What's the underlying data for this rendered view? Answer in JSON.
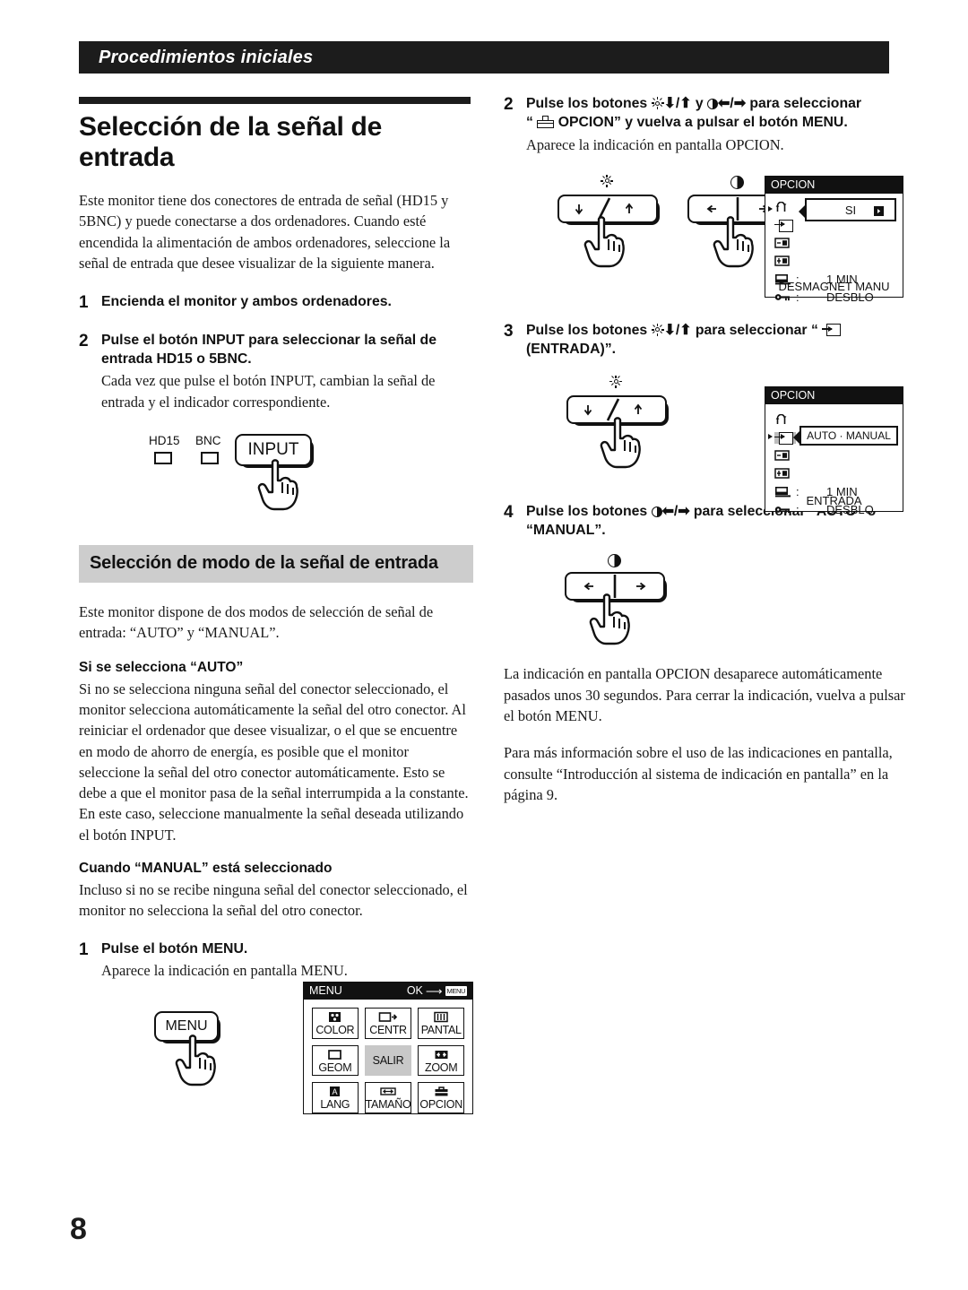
{
  "running_head": "Procedimientos iniciales",
  "page_number": "8",
  "left": {
    "title": "Selección de la señal de entrada",
    "intro": "Este monitor tiene dos conectores de entrada de señal (HD15 y 5BNC) y puede conectarse a dos ordenadores. Cuando esté encendida la alimentación de ambos ordenadores, seleccione la señal de entrada que desee visualizar de la siguiente manera.",
    "steps": [
      {
        "num": "1",
        "title": "Encienda el monitor y ambos ordenadores.",
        "sub": ""
      },
      {
        "num": "2",
        "title": "Pulse el botón INPUT para seleccionar la señal de entrada HD15 o 5BNC.",
        "sub": "Cada vez que pulse el botón INPUT, cambian la señal de entrada y el indicador correspondiente."
      }
    ],
    "input_illus": {
      "label_hd15": "HD15",
      "label_bnc": "BNC",
      "button_label": "INPUT"
    },
    "subhead": "Selección de modo de la señal de entrada",
    "mode_intro": "Este monitor dispone de dos modos de selección de señal de entrada: “AUTO” y “MANUAL”.",
    "auto_head": "Si se selecciona “AUTO”",
    "auto_body": "Si no se selecciona ninguna señal del conector seleccionado, el monitor selecciona automáticamente la señal del otro conector. Al reiniciar el ordenador que desee visualizar, o el que se encuentre en modo de ahorro de energía, es posible que el monitor seleccione la señal del otro conector automáticamente. Esto se debe a que el monitor pasa de la señal interrumpida a la constante. En este caso, seleccione manualmente la señal deseada utilizando el botón INPUT.",
    "manual_head": "Cuando “MANUAL” está seleccionado",
    "manual_body": "Incluso si no se recibe ninguna señal del conector seleccionado, el monitor no selecciona la señal del otro conector.",
    "step_menu": {
      "num": "1",
      "title": "Pulse el botón MENU.",
      "sub": "Aparece la indicación en pantalla MENU."
    },
    "menu_button_label": "MENU",
    "menu_osd": {
      "title": "MENU",
      "ok_label": "OK",
      "ok_key": "MENU",
      "cells": [
        {
          "icon": "color-icon",
          "label": "COLOR"
        },
        {
          "icon": "centr-icon",
          "label": "CENTR"
        },
        {
          "icon": "pantal-icon",
          "label": "PANTAL"
        },
        {
          "icon": "geom-icon",
          "label": "GEOM"
        },
        {
          "icon": "salir-icon",
          "label": "SALIR"
        },
        {
          "icon": "zoom-icon",
          "label": "ZOOM"
        },
        {
          "icon": "lang-icon",
          "label": "LANG"
        },
        {
          "icon": "tamano-icon",
          "label": "TAMAÑO"
        },
        {
          "icon": "opcion-icon",
          "label": "OPCION"
        }
      ],
      "selected_index": 4
    }
  },
  "right": {
    "steps": [
      {
        "num": "2",
        "title_pre": "Pulse los botones",
        "title_mid": "y",
        "title_post": "para seleccionar",
        "title_line2_pre": "“",
        "title_line2_post": "OPCION” y vuelva a pulsar el botón MENU.",
        "sub": "Aparece la indicación en pantalla OPCION."
      },
      {
        "num": "3",
        "title_pre": "Pulse los botones",
        "title_post": "para seleccionar “",
        "title_line2": "(ENTRADA)”."
      },
      {
        "num": "4",
        "title_pre": "Pulse los botones",
        "title_post": "para seleccionar “AUTO” o",
        "title_line2": "“MANUAL”."
      }
    ],
    "opcion_osd_1": {
      "title": "OPCION",
      "callout_value": "SI",
      "rows": [
        {
          "icon": "degauss-icon",
          "value": ""
        },
        {
          "icon": "entrada-icon",
          "value": ""
        },
        {
          "icon": "h-moire-icon",
          "value": ""
        },
        {
          "icon": "v-moire-icon",
          "value": ""
        },
        {
          "icon": "osd-timer-icon",
          "value": "1 MIN",
          "colon": ":"
        },
        {
          "icon": "lock-key-icon",
          "value": "DESBLO",
          "colon": ":"
        }
      ],
      "footer": "DESMAGNET MANU"
    },
    "opcion_osd_2": {
      "title": "OPCION",
      "callout_value": "AUTO · MANUAL",
      "rows": [
        {
          "icon": "degauss-icon",
          "value": ""
        },
        {
          "icon": "entrada-icon",
          "value": ""
        },
        {
          "icon": "h-moire-icon",
          "value": ""
        },
        {
          "icon": "v-moire-icon",
          "value": ""
        },
        {
          "icon": "osd-timer-icon",
          "value": "1 MIN",
          "colon": ":"
        },
        {
          "icon": "lock-key-icon",
          "value": "DESBLO",
          "colon": ":"
        }
      ],
      "footer": "ENTRADA"
    },
    "closing_1": "La indicación en pantalla OPCION desaparece automáticamente pasados unos 30 segundos. Para cerrar la indicación, vuelva a pulsar el botón MENU.",
    "closing_2": "Para más información sobre el uso de las indicaciones en pantalla, consulte “Introducción al sistema de indicación en pantalla” en la página 9."
  }
}
